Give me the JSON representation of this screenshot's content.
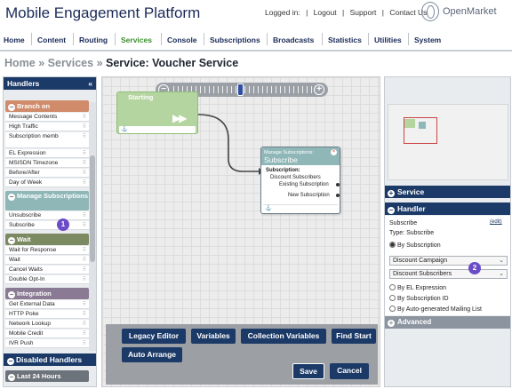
{
  "header": {
    "app_title": "Mobile Engagement Platform",
    "logged_in": "Logged in:",
    "separator": "|",
    "logout": "Logout",
    "support": "Support",
    "contact": "Contact Us",
    "logo_text": "OpenMarket"
  },
  "mainnav": {
    "items": [
      "Home",
      "Content",
      "Routing",
      "Services",
      "Console",
      "Subscriptions",
      "Broadcasts",
      "Statistics",
      "Utilities",
      "System"
    ],
    "active": "Services"
  },
  "breadcrumb": {
    "home": "Home",
    "sep": "»",
    "services": "Services",
    "current": "Service: Voucher Service"
  },
  "handlers": {
    "title": "Handlers",
    "collapse_glyph": "«",
    "groups": {
      "branch_on": {
        "label": "Branch on",
        "items": [
          "Message Contents",
          "High Traffic",
          "Subscription membership",
          "EL Expression",
          "MSISDN Timezone",
          "Before/After",
          "Day of Week"
        ]
      },
      "manage_subscriptions": {
        "label": "Manage Subscriptions",
        "items": [
          "Unsubscribe",
          "Subscribe"
        ]
      },
      "wait": {
        "label": "Wait",
        "items": [
          "Wait for Response",
          "Wait",
          "Cancel Waits",
          "Double Opt-In"
        ]
      },
      "integration": {
        "label": "Integration",
        "items": [
          "Get External Data",
          "HTTP Poke",
          "Network Lookup",
          "Mobile Credit",
          "IVR Push"
        ]
      }
    },
    "disabled_title": "Disabled Handlers",
    "last_24": "Last 24 Hours",
    "grip": "⠿",
    "badge_1": "1",
    "badge_2": "2"
  },
  "canvas": {
    "start_node": "Starting",
    "play_glyph": "▶▶",
    "sub_node_kind": "Manage Subscriptions:",
    "sub_node_name": "Subscribe",
    "sub_line_1": "Subscription:",
    "sub_line_2": "Discount Subscribers",
    "sub_line_3": "Existing Subscription",
    "sub_line_4": "New Subscription",
    "close_glyph": "×",
    "zoom_minus": "−",
    "zoom_plus": "+"
  },
  "toolbar": {
    "legacy_editor": "Legacy Editor",
    "variables": "Variables",
    "collection_variables": "Collection Variables",
    "find_start": "Find Start",
    "auto_arrange": "Auto Arrange",
    "save": "Save",
    "cancel": "Cancel"
  },
  "right": {
    "service_title": "Service",
    "handler_title": "Handler",
    "handler_name": "Subscribe",
    "edit_link": "(edit)",
    "type_text": "Type: Subscribe",
    "by_subscription": "By Subscription",
    "campaign_select": "Discount Campaign",
    "subscribers_select": "Discount Subscribers",
    "by_el": "By EL Expression",
    "by_sub_id": "By Subscription ID",
    "by_auto": "By Auto-generated Mailing List",
    "advanced": "Advanced"
  },
  "colors": {
    "nav_blue": "#1c3a68",
    "active_green": "#3c8f2f",
    "badge_purple": "#6a4cc9"
  }
}
